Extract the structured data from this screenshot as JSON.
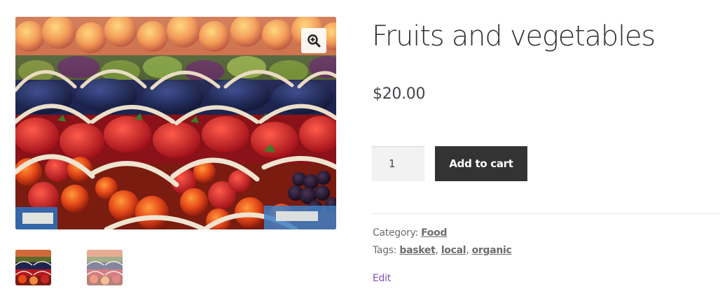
{
  "product": {
    "title": "Fruits and vegetables",
    "price": "$20.00",
    "quantity": "1",
    "add_to_cart_label": "Add to cart"
  },
  "meta": {
    "category_label": "Category:",
    "category": "Food",
    "tags_label": "Tags:",
    "tags": [
      "basket",
      "local",
      "organic"
    ],
    "separator": ", "
  },
  "admin": {
    "edit_label": "Edit"
  },
  "gallery": {
    "zoom_icon": "zoom-in-icon",
    "thumbnail_count": 2,
    "active_thumbnail": 1
  },
  "colors": {
    "button_bg": "#333333",
    "button_text": "#ffffff",
    "text": "#43454b",
    "meta_text": "#6d6d6d",
    "edit_link": "#7f54b3",
    "quantity_bg": "#f2f2f2"
  }
}
